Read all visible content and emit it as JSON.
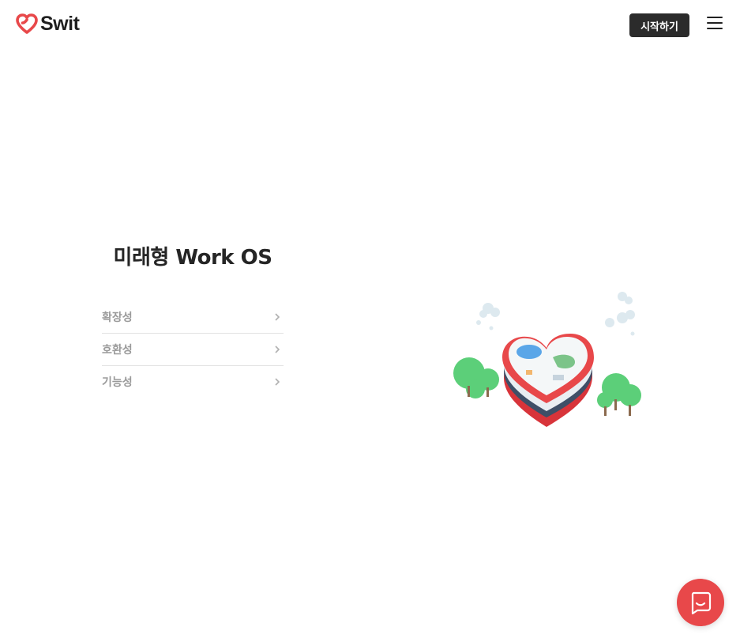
{
  "header": {
    "logo_text": "Swit",
    "start_button": "시작하기",
    "brand_color": "#e8484a"
  },
  "hero": {
    "title": "미래형 Work OS",
    "features": [
      {
        "label": "확장성"
      },
      {
        "label": "호환성"
      },
      {
        "label": "기능성"
      }
    ]
  },
  "icons": {
    "logo": "heart-infinity-icon",
    "menu": "hamburger-menu-icon",
    "chevron": "chevron-right-icon",
    "chat": "chat-bubble-icon"
  }
}
